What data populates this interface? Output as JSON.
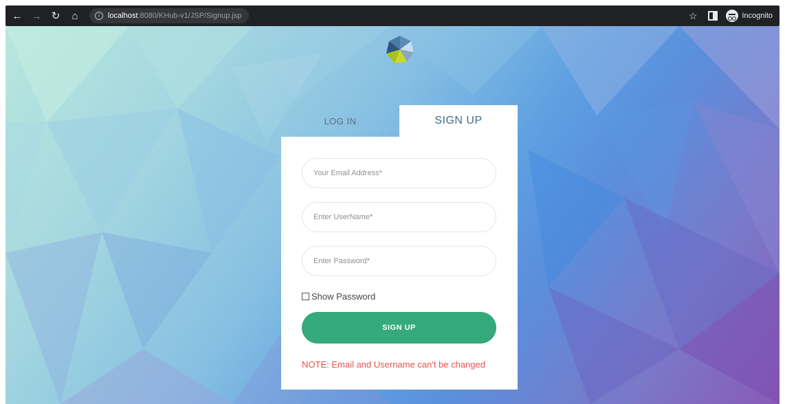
{
  "browser": {
    "url_host": "localhost",
    "url_path": ":8080/KHub-v1/JSP/Signup.jsp",
    "profile_label": "Incognito",
    "icons": [
      "back-icon",
      "forward-icon",
      "reload-icon",
      "home-icon",
      "info-icon",
      "star-icon",
      "side-panel-icon",
      "incognito-icon"
    ]
  },
  "tabs": {
    "login_label": "LOG IN",
    "signup_label": "SIGN UP",
    "active": "signup"
  },
  "form": {
    "email_placeholder": "Your Email Address*",
    "email_value": "",
    "username_placeholder": "Enter UserName*",
    "username_value": "",
    "password_placeholder": "Enter Password*",
    "password_value": "",
    "show_password_label": "Show Password",
    "show_password_checked": false,
    "submit_label": "SIGN UP",
    "note": "NOTE: Email and Username can't be changed"
  },
  "colors": {
    "accent_green": "#34a97c",
    "note_red": "#e8524f",
    "tab_active_text": "#3f6b8c"
  }
}
